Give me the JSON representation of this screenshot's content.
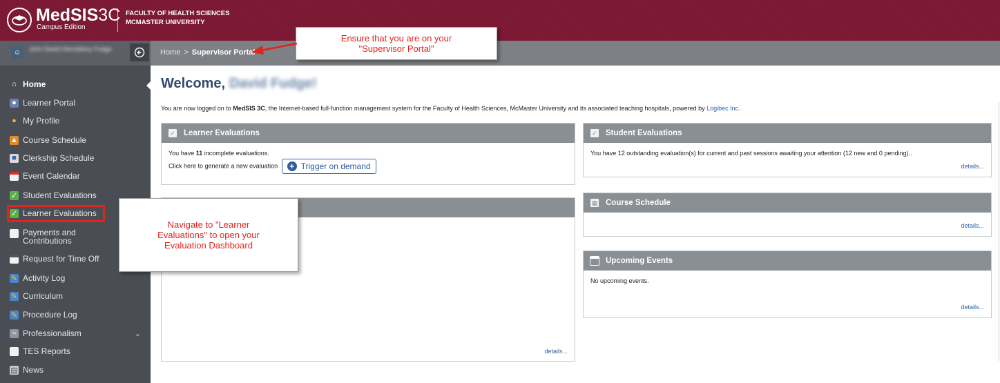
{
  "header": {
    "logo_main": "MedSIS",
    "logo_version": "3C",
    "logo_sub": "Campus Edition",
    "faculty_line1": "FACULTY OF HEALTH SCIENCES",
    "faculty_line2": "MCMASTER UNIVERSITY",
    "brand_color": "#7a1530"
  },
  "userbar": {
    "user_name": "John David Hennebery Fudge",
    "collapse_icon": "circle-arrow-left-icon"
  },
  "breadcrumb": {
    "home": "Home",
    "separator": ">",
    "current": "Supervisor Portal"
  },
  "sidebar": {
    "items": [
      {
        "label": "Home",
        "icon": "home-icon"
      },
      {
        "label": "Learner Portal",
        "icon": "learner-portal-icon"
      },
      {
        "label": "My Profile",
        "icon": "profile-icon"
      },
      {
        "label": "Course Schedule",
        "icon": "course-schedule-icon"
      },
      {
        "label": "Clerkship Schedule",
        "icon": "clerkship-icon"
      },
      {
        "label": "Event Calendar",
        "icon": "calendar-icon"
      },
      {
        "label": "Student Evaluations",
        "icon": "evaluation-icon"
      },
      {
        "label": "Learner Evaluations",
        "icon": "evaluation-icon"
      },
      {
        "label": "Payments and Contributions",
        "icon": "payments-icon"
      },
      {
        "label": "Request for Time Off",
        "icon": "calendar-icon"
      },
      {
        "label": "Activity Log",
        "icon": "log-icon"
      },
      {
        "label": "Curriculum",
        "icon": "log-icon"
      },
      {
        "label": "Procedure Log",
        "icon": "log-icon"
      },
      {
        "label": "Professionalism",
        "icon": "chart-icon"
      },
      {
        "label": "TES Reports",
        "icon": "report-icon"
      },
      {
        "label": "News",
        "icon": "news-icon"
      }
    ]
  },
  "main": {
    "welcome_prefix": "Welcome,",
    "welcome_name": "David Fudge!",
    "intro_part1": "You are now logged on to ",
    "intro_bold": "MedSIS 3C",
    "intro_part2": ", the Internet-based full-function management system for the Faculty of Health Sciences, McMaster University and its associated teaching hospitals, powered by ",
    "intro_link": "Logibec Inc",
    "intro_end": "."
  },
  "panels": {
    "learner_evaluations": {
      "title": "Learner Evaluations",
      "line1_pre": "You have ",
      "line1_count": "11",
      "line1_post": " incomplete evaluations.",
      "line2": "Click here to generate a new evaluation",
      "button": "Trigger on demand"
    },
    "hidden_panel": {
      "details": "details..."
    },
    "student_evaluations": {
      "title": "Student Evaluations",
      "text": "You have 12 outstanding evaluation(s) for current and past sessions awaiting your attention (12 new and 0 pending)..",
      "details": "details..."
    },
    "course_schedule": {
      "title": "Course Schedule",
      "details": "details..."
    },
    "upcoming_events": {
      "title": "Upcoming Events",
      "text": "No upcoming events.",
      "details": "details..."
    }
  },
  "callouts": {
    "portal": [
      "Ensure that you are on your",
      "\"Supervisor Portal\""
    ],
    "learner_eval": [
      "Navigate to \"Learner",
      "Evaluations\" to open your",
      "Evaluation Dashboard"
    ],
    "annotation_color": "#e0231c"
  }
}
